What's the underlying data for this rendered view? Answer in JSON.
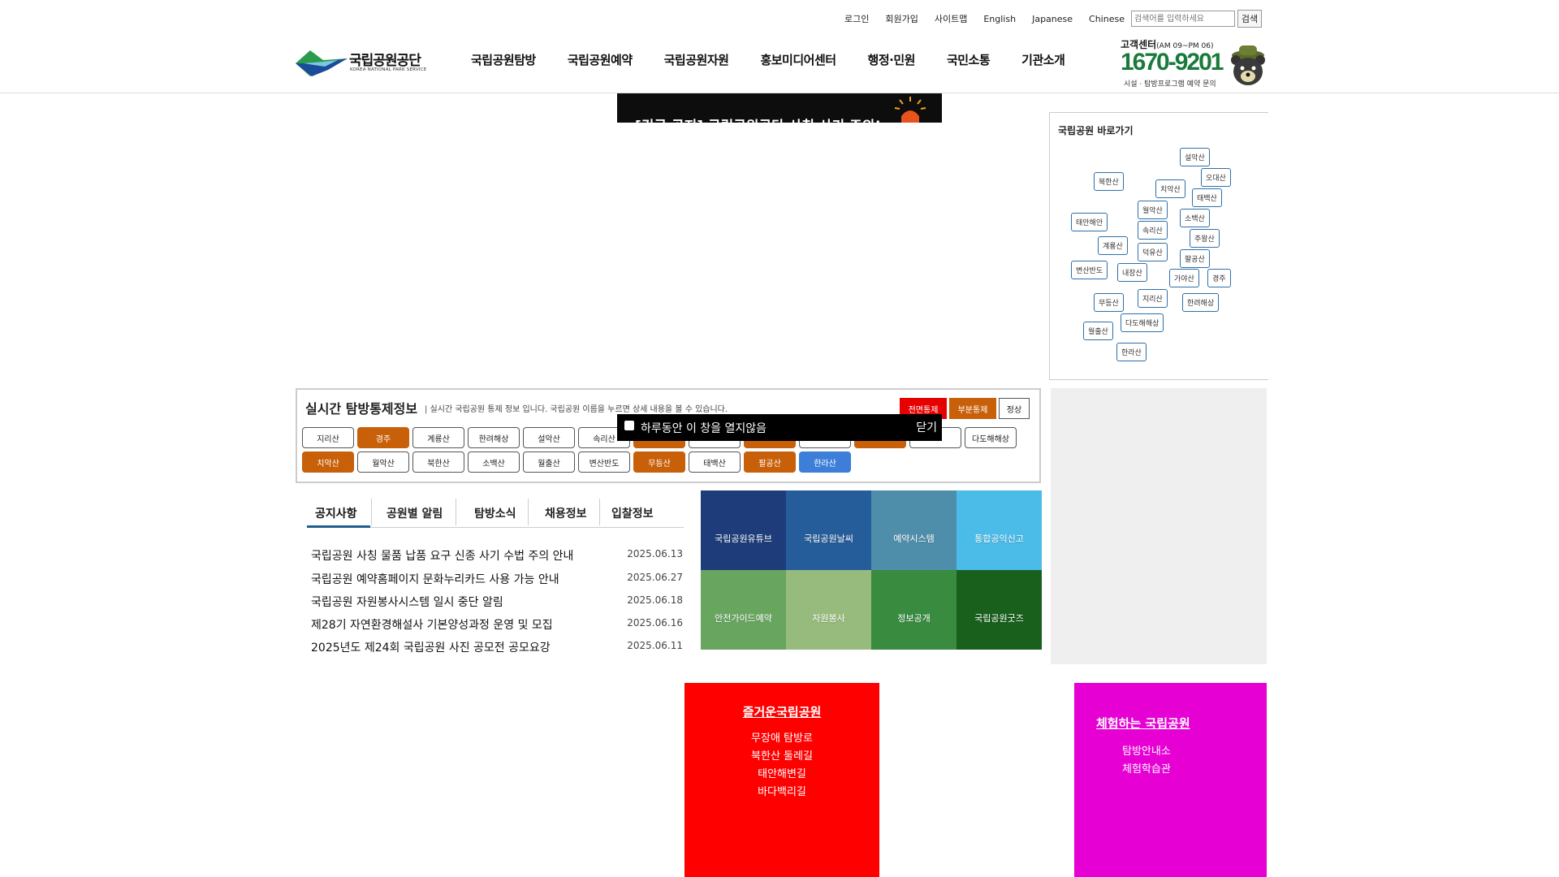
{
  "util": {
    "links": [
      "로그인",
      "회원가입",
      "사이트맵",
      "English",
      "Japanese",
      "Chinese"
    ],
    "search_placeholder": "검색어를 입력하세요",
    "search_button": "검색"
  },
  "logo": {
    "name": "국립공원공단",
    "english": "KOREA NATIONAL PARK SERVICE"
  },
  "gnb": [
    "국립공원탐방",
    "국립공원예약",
    "국립공원자원",
    "홍보미디어센터",
    "행정·민원",
    "국민소통",
    "기관소개"
  ],
  "customer_center": {
    "title": "고객센터",
    "hours": "(AM 09~PM 06)",
    "phone": "1670-9201",
    "subtitle": "시설 · 탐방프로그램 예약 문의"
  },
  "popup": {
    "banner_text": "[긴급 공지] 국립공원공단 사칭 사기 주의!",
    "dont_show_label": "하루동안 이 창을 열지않음",
    "close_label": "닫기"
  },
  "park_map": {
    "title": "국립공원 바로가기",
    "parks": [
      "설악산",
      "북한산",
      "오대산",
      "치악산",
      "태백산",
      "월악산",
      "소백산",
      "태안해안",
      "속리산",
      "주왕산",
      "계룡산",
      "덕유산",
      "팔공산",
      "변산반도",
      "내장산",
      "가야산",
      "경주",
      "무등산",
      "지리산",
      "한려해상",
      "다도해해상",
      "월출산",
      "한라산"
    ]
  },
  "live_control": {
    "title": "실시간 탐방통제정보",
    "description": "| 실시간 국립공원 통제 정보 입니다. 국립공원 이름을 누르면 상세 내용을 볼 수 있습니다.",
    "legend": {
      "full": "전면통제",
      "partial": "부분통제",
      "normal": "정상"
    },
    "colors": {
      "full": "#e60000",
      "partial": "#c8600a",
      "normal": "#ffffff",
      "selected": "#3d7fd8"
    },
    "row1": [
      {
        "name": "지리산",
        "status": "normal"
      },
      {
        "name": "경주",
        "status": "partial"
      },
      {
        "name": "계룡산",
        "status": "normal"
      },
      {
        "name": "한려해상",
        "status": "normal"
      },
      {
        "name": "설악산",
        "status": "normal"
      },
      {
        "name": "속리산",
        "status": "normal"
      },
      {
        "name": "",
        "status": "partial"
      },
      {
        "name": "",
        "status": "normal"
      },
      {
        "name": "",
        "status": "partial"
      },
      {
        "name": "",
        "status": "normal"
      },
      {
        "name": "",
        "status": "partial"
      },
      {
        "name": "",
        "status": "normal"
      },
      {
        "name": "다도해해상",
        "status": "normal"
      }
    ],
    "row2": [
      {
        "name": "치악산",
        "status": "partial"
      },
      {
        "name": "월악산",
        "status": "normal"
      },
      {
        "name": "북한산",
        "status": "normal"
      },
      {
        "name": "소백산",
        "status": "normal"
      },
      {
        "name": "월출산",
        "status": "normal"
      },
      {
        "name": "변산반도",
        "status": "normal"
      },
      {
        "name": "무등산",
        "status": "partial"
      },
      {
        "name": "태백산",
        "status": "normal"
      },
      {
        "name": "팔공산",
        "status": "partial"
      },
      {
        "name": "한라산",
        "status": "selected"
      }
    ]
  },
  "notice_tabs": [
    "공지사항",
    "공원별 알림",
    "탐방소식",
    "채용정보",
    "입찰정보"
  ],
  "notices": [
    {
      "title": "국립공원 사칭 물품 납품 요구 신종 사기 수법 주의 안내",
      "date": "2025.06.13"
    },
    {
      "title": "국립공원 예약홈페이지 문화누리카드 사용 가능 안내",
      "date": "2025.06.27"
    },
    {
      "title": "국립공원 자원봉사시스템 일시 중단 알림",
      "date": "2025.06.18"
    },
    {
      "title": "제28기 자연환경해설사 기본양성과정 운영 및 모집",
      "date": "2025.06.16"
    },
    {
      "title": "2025년도 제24회 국립공원 사진 공모전 공모요강",
      "date": "2025.06.11"
    }
  ],
  "tiles": [
    {
      "label": "국립공원유튜브",
      "color": "#1e3c7a"
    },
    {
      "label": "국립공원날씨",
      "color": "#255d9b"
    },
    {
      "label": "예약시스템",
      "color": "#4f8eaa"
    },
    {
      "label": "통합공익신고",
      "color": "#4bbbe7"
    },
    {
      "label": "안전가이드예약",
      "color": "#68a660"
    },
    {
      "label": "자원봉사",
      "color": "#96bb7c"
    },
    {
      "label": "정보공개",
      "color": "#388b3f"
    },
    {
      "label": "국립공원굿즈",
      "color": "#19601d"
    }
  ],
  "fun_parks": {
    "title": "즐거운국립공원",
    "links": [
      "무장애 탐방로",
      "북한산 둘레길",
      "태안해변길",
      "바다백리길"
    ]
  },
  "experience_parks": {
    "title": "체험하는 국립공원",
    "links": [
      "탐방안내소",
      "체험학습관"
    ]
  }
}
